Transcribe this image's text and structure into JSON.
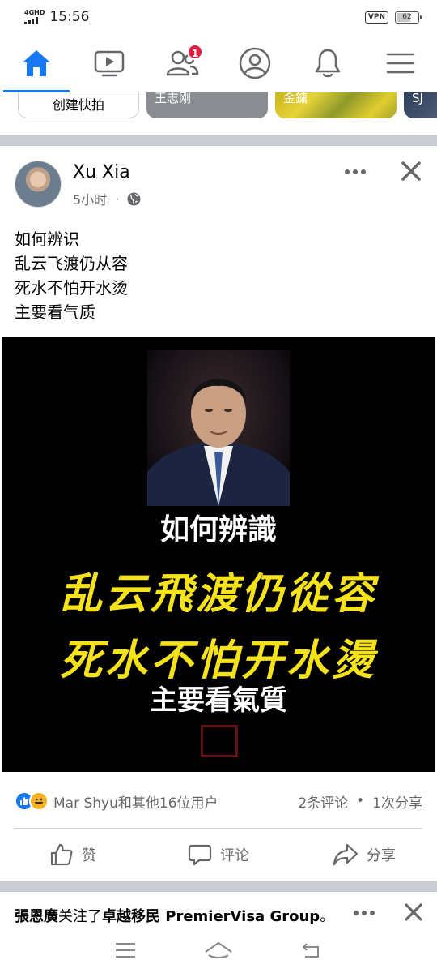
{
  "status_bar": {
    "network": "4GHD",
    "time": "15:56",
    "vpn": "VPN",
    "battery": "62",
    "battery_level": 0.62
  },
  "nav": {
    "items": [
      {
        "icon": "home-icon",
        "active": true
      },
      {
        "icon": "video-icon",
        "active": false
      },
      {
        "icon": "friends-icon",
        "active": false,
        "badge": "1"
      },
      {
        "icon": "profile-icon",
        "active": false
      },
      {
        "icon": "bell-icon",
        "active": false
      },
      {
        "icon": "menu-icon",
        "active": false
      }
    ],
    "accent_color": "#1877f2"
  },
  "stories": {
    "create_label": "创建快拍",
    "cards": [
      {
        "name": "王志刚"
      },
      {
        "name": "金鏞"
      },
      {
        "name": "SJ"
      }
    ]
  },
  "post": {
    "author": "Xu Xia",
    "time": "5小时",
    "separator": "·",
    "privacy_icon": "globe-icon",
    "text_lines": [
      "如何辨识",
      "乱云飞渡仍从容",
      "死水不怕开水烫",
      "主要看气质"
    ],
    "image_text": {
      "line1": "如何辨識",
      "line2": "乱云飛渡仍從容",
      "line3": "死水不怕开水燙",
      "line4": "主要看氣質"
    },
    "reactions_text": "Mar Shyu和其他16位用户",
    "comments": "2条评论",
    "dot": "•",
    "shares": "1次分享",
    "actions": {
      "like": "赞",
      "comment": "评论",
      "share": "分享"
    }
  },
  "next_post": {
    "actor": "張恩廣",
    "verb": "关注了",
    "target": "卓越移民 PremierVisa Group",
    "suffix": "。"
  }
}
